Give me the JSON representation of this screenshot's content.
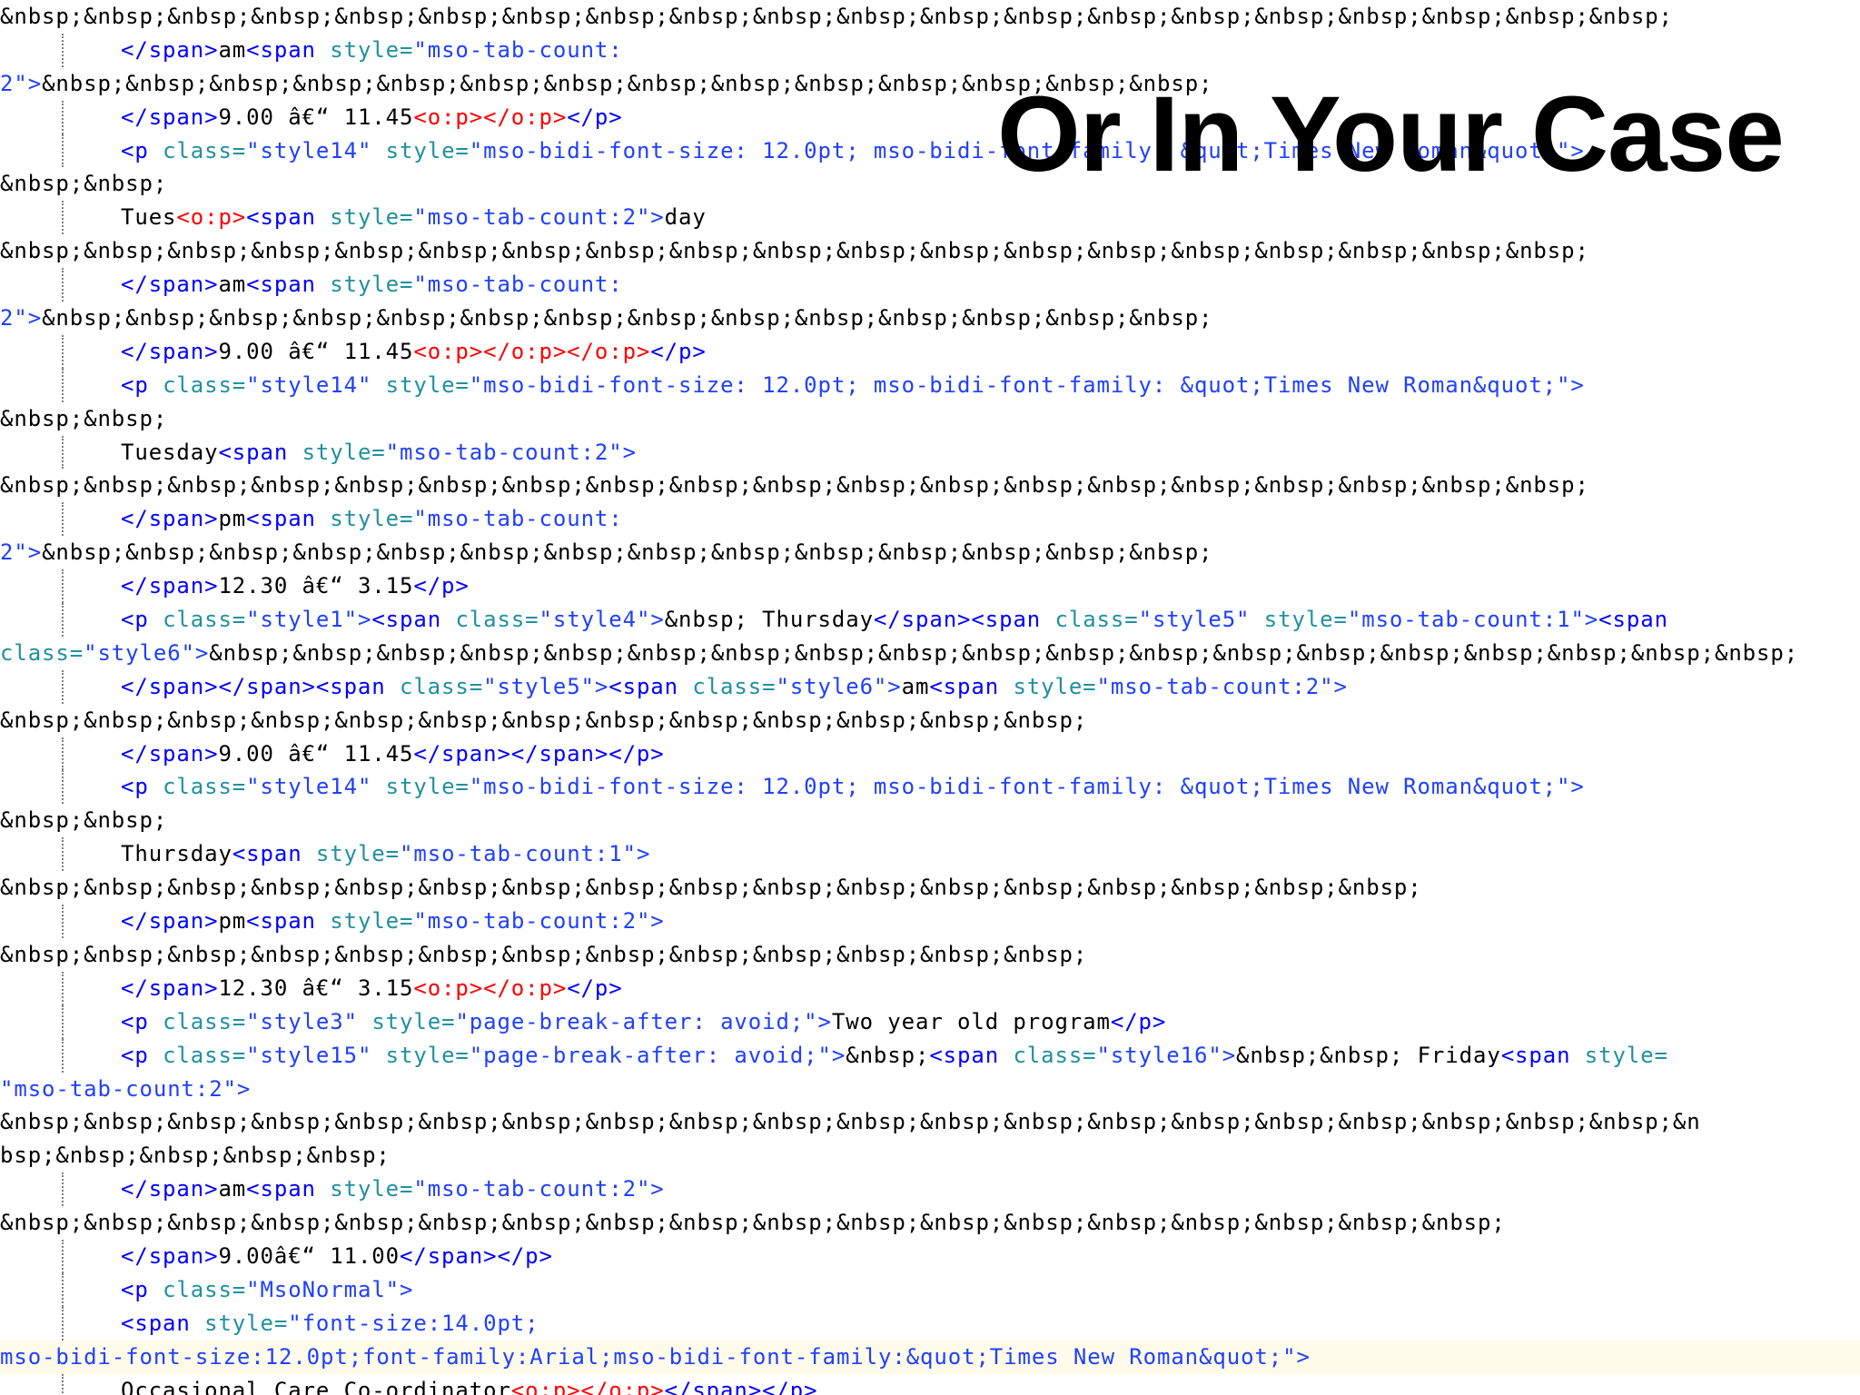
{
  "overlay_title": "Or In Your Case",
  "code_lines": [
    {
      "indent": false,
      "highlight": false,
      "segments": [
        {
          "k": "tx",
          "t": "&nbsp;&nbsp;&nbsp;&nbsp;&nbsp;&nbsp;&nbsp;&nbsp;&nbsp;&nbsp;&nbsp;&nbsp;&nbsp;&nbsp;&nbsp;&nbsp;&nbsp;&nbsp;&nbsp;&nbsp;"
        }
      ]
    },
    {
      "indent": true,
      "highlight": false,
      "segments": [
        {
          "k": "tg",
          "t": "</span>"
        },
        {
          "k": "tx",
          "t": "am"
        },
        {
          "k": "tg",
          "t": "<span "
        },
        {
          "k": "at",
          "t": "style="
        },
        {
          "k": "vl",
          "t": "\"mso-tab-count:"
        }
      ]
    },
    {
      "indent": false,
      "highlight": false,
      "segments": [
        {
          "k": "vl",
          "t": "2\">"
        },
        {
          "k": "tx",
          "t": "&nbsp;&nbsp;&nbsp;&nbsp;&nbsp;&nbsp;&nbsp;&nbsp;&nbsp;&nbsp;&nbsp;&nbsp;&nbsp;&nbsp;"
        }
      ]
    },
    {
      "indent": true,
      "highlight": false,
      "segments": [
        {
          "k": "tg",
          "t": "</span>"
        },
        {
          "k": "tx",
          "t": "9.00 â€“ 11.45"
        },
        {
          "k": "rd",
          "t": "<o:p></o:p>"
        },
        {
          "k": "tg",
          "t": "</p>"
        }
      ]
    },
    {
      "indent": true,
      "highlight": false,
      "segments": [
        {
          "k": "tg",
          "t": "<p "
        },
        {
          "k": "at",
          "t": "class="
        },
        {
          "k": "vl",
          "t": "\"style14\" "
        },
        {
          "k": "at",
          "t": "style="
        },
        {
          "k": "vl",
          "t": "\"mso-bidi-font-size: 12.0pt; mso-bidi-font-family: &quot;Times New Roman&quot;\">"
        }
      ]
    },
    {
      "indent": false,
      "highlight": false,
      "segments": [
        {
          "k": "tx",
          "t": "&nbsp;&nbsp;"
        }
      ]
    },
    {
      "indent": true,
      "highlight": false,
      "segments": [
        {
          "k": "tx",
          "t": "Tues"
        },
        {
          "k": "rd",
          "t": "<o:p>"
        },
        {
          "k": "tg",
          "t": "<span "
        },
        {
          "k": "at",
          "t": "style="
        },
        {
          "k": "vl",
          "t": "\"mso-tab-count:2\">"
        },
        {
          "k": "tx",
          "t": "day"
        }
      ]
    },
    {
      "indent": false,
      "highlight": false,
      "segments": [
        {
          "k": "tx",
          "t": "&nbsp;&nbsp;&nbsp;&nbsp;&nbsp;&nbsp;&nbsp;&nbsp;&nbsp;&nbsp;&nbsp;&nbsp;&nbsp;&nbsp;&nbsp;&nbsp;&nbsp;&nbsp;&nbsp;"
        }
      ]
    },
    {
      "indent": true,
      "highlight": false,
      "segments": [
        {
          "k": "tg",
          "t": "</span>"
        },
        {
          "k": "tx",
          "t": "am"
        },
        {
          "k": "tg",
          "t": "<span "
        },
        {
          "k": "at",
          "t": "style="
        },
        {
          "k": "vl",
          "t": "\"mso-tab-count:"
        }
      ]
    },
    {
      "indent": false,
      "highlight": false,
      "segments": [
        {
          "k": "vl",
          "t": "2\">"
        },
        {
          "k": "tx",
          "t": "&nbsp;&nbsp;&nbsp;&nbsp;&nbsp;&nbsp;&nbsp;&nbsp;&nbsp;&nbsp;&nbsp;&nbsp;&nbsp;&nbsp;"
        }
      ]
    },
    {
      "indent": true,
      "highlight": false,
      "segments": [
        {
          "k": "tg",
          "t": "</span>"
        },
        {
          "k": "tx",
          "t": "9.00 â€“ 11.45"
        },
        {
          "k": "rd",
          "t": "<o:p></o:p></o:p>"
        },
        {
          "k": "tg",
          "t": "</p>"
        }
      ]
    },
    {
      "indent": true,
      "highlight": false,
      "segments": [
        {
          "k": "tg",
          "t": "<p "
        },
        {
          "k": "at",
          "t": "class="
        },
        {
          "k": "vl",
          "t": "\"style14\" "
        },
        {
          "k": "at",
          "t": "style="
        },
        {
          "k": "vl",
          "t": "\"mso-bidi-font-size: 12.0pt; mso-bidi-font-family: &quot;Times New Roman&quot;\">"
        }
      ]
    },
    {
      "indent": false,
      "highlight": false,
      "segments": [
        {
          "k": "tx",
          "t": "&nbsp;&nbsp;"
        }
      ]
    },
    {
      "indent": true,
      "highlight": false,
      "segments": [
        {
          "k": "tx",
          "t": "Tuesday"
        },
        {
          "k": "tg",
          "t": "<span "
        },
        {
          "k": "at",
          "t": "style="
        },
        {
          "k": "vl",
          "t": "\"mso-tab-count:2\">"
        }
      ]
    },
    {
      "indent": false,
      "highlight": false,
      "segments": [
        {
          "k": "tx",
          "t": "&nbsp;&nbsp;&nbsp;&nbsp;&nbsp;&nbsp;&nbsp;&nbsp;&nbsp;&nbsp;&nbsp;&nbsp;&nbsp;&nbsp;&nbsp;&nbsp;&nbsp;&nbsp;&nbsp;"
        }
      ]
    },
    {
      "indent": true,
      "highlight": false,
      "segments": [
        {
          "k": "tg",
          "t": "</span>"
        },
        {
          "k": "tx",
          "t": "pm"
        },
        {
          "k": "tg",
          "t": "<span "
        },
        {
          "k": "at",
          "t": "style="
        },
        {
          "k": "vl",
          "t": "\"mso-tab-count:"
        }
      ]
    },
    {
      "indent": false,
      "highlight": false,
      "segments": [
        {
          "k": "vl",
          "t": "2\">"
        },
        {
          "k": "tx",
          "t": "&nbsp;&nbsp;&nbsp;&nbsp;&nbsp;&nbsp;&nbsp;&nbsp;&nbsp;&nbsp;&nbsp;&nbsp;&nbsp;&nbsp;"
        }
      ]
    },
    {
      "indent": true,
      "highlight": false,
      "segments": [
        {
          "k": "tg",
          "t": "</span>"
        },
        {
          "k": "tx",
          "t": "12.30 â€“ 3.15"
        },
        {
          "k": "tg",
          "t": "</p>"
        }
      ]
    },
    {
      "indent": true,
      "highlight": false,
      "segments": [
        {
          "k": "tg",
          "t": "<p "
        },
        {
          "k": "at",
          "t": "class="
        },
        {
          "k": "vl",
          "t": "\"style1\">"
        },
        {
          "k": "tg",
          "t": "<span "
        },
        {
          "k": "at",
          "t": "class="
        },
        {
          "k": "vl",
          "t": "\"style4\">"
        },
        {
          "k": "tx",
          "t": "&nbsp; Thursday"
        },
        {
          "k": "tg",
          "t": "</span><span "
        },
        {
          "k": "at",
          "t": "class="
        },
        {
          "k": "vl",
          "t": "\"style5\" "
        },
        {
          "k": "at",
          "t": "style="
        },
        {
          "k": "vl",
          "t": "\"mso-tab-count:1\">"
        },
        {
          "k": "tg",
          "t": "<span"
        }
      ]
    },
    {
      "indent": false,
      "highlight": false,
      "segments": [
        {
          "k": "at",
          "t": "class="
        },
        {
          "k": "vl",
          "t": "\"style6\">"
        },
        {
          "k": "tx",
          "t": "&nbsp;&nbsp;&nbsp;&nbsp;&nbsp;&nbsp;&nbsp;&nbsp;&nbsp;&nbsp;&nbsp;&nbsp;&nbsp;&nbsp;&nbsp;&nbsp;&nbsp;&nbsp;&nbsp;"
        }
      ]
    },
    {
      "indent": true,
      "highlight": false,
      "segments": [
        {
          "k": "tg",
          "t": "</span></span><span "
        },
        {
          "k": "at",
          "t": "class="
        },
        {
          "k": "vl",
          "t": "\"style5\">"
        },
        {
          "k": "tg",
          "t": "<span "
        },
        {
          "k": "at",
          "t": "class="
        },
        {
          "k": "vl",
          "t": "\"style6\">"
        },
        {
          "k": "tx",
          "t": "am"
        },
        {
          "k": "tg",
          "t": "<span "
        },
        {
          "k": "at",
          "t": "style="
        },
        {
          "k": "vl",
          "t": "\"mso-tab-count:2\">"
        }
      ]
    },
    {
      "indent": false,
      "highlight": false,
      "segments": [
        {
          "k": "tx",
          "t": "&nbsp;&nbsp;&nbsp;&nbsp;&nbsp;&nbsp;&nbsp;&nbsp;&nbsp;&nbsp;&nbsp;&nbsp;&nbsp;"
        }
      ]
    },
    {
      "indent": true,
      "highlight": false,
      "segments": [
        {
          "k": "tg",
          "t": "</span>"
        },
        {
          "k": "tx",
          "t": "9.00 â€“ 11.45"
        },
        {
          "k": "tg",
          "t": "</span></span></p>"
        }
      ]
    },
    {
      "indent": true,
      "highlight": false,
      "segments": [
        {
          "k": "tg",
          "t": "<p "
        },
        {
          "k": "at",
          "t": "class="
        },
        {
          "k": "vl",
          "t": "\"style14\" "
        },
        {
          "k": "at",
          "t": "style="
        },
        {
          "k": "vl",
          "t": "\"mso-bidi-font-size: 12.0pt; mso-bidi-font-family: &quot;Times New Roman&quot;\">"
        }
      ]
    },
    {
      "indent": false,
      "highlight": false,
      "segments": [
        {
          "k": "tx",
          "t": "&nbsp;&nbsp;"
        }
      ]
    },
    {
      "indent": true,
      "highlight": false,
      "segments": [
        {
          "k": "tx",
          "t": "Thursday"
        },
        {
          "k": "tg",
          "t": "<span "
        },
        {
          "k": "at",
          "t": "style="
        },
        {
          "k": "vl",
          "t": "\"mso-tab-count:1\">"
        }
      ]
    },
    {
      "indent": false,
      "highlight": false,
      "segments": [
        {
          "k": "tx",
          "t": "&nbsp;&nbsp;&nbsp;&nbsp;&nbsp;&nbsp;&nbsp;&nbsp;&nbsp;&nbsp;&nbsp;&nbsp;&nbsp;&nbsp;&nbsp;&nbsp;&nbsp;"
        }
      ]
    },
    {
      "indent": true,
      "highlight": false,
      "segments": [
        {
          "k": "tg",
          "t": "</span>"
        },
        {
          "k": "tx",
          "t": "pm"
        },
        {
          "k": "tg",
          "t": "<span "
        },
        {
          "k": "at",
          "t": "style="
        },
        {
          "k": "vl",
          "t": "\"mso-tab-count:2\">"
        }
      ]
    },
    {
      "indent": false,
      "highlight": false,
      "segments": [
        {
          "k": "tx",
          "t": "&nbsp;&nbsp;&nbsp;&nbsp;&nbsp;&nbsp;&nbsp;&nbsp;&nbsp;&nbsp;&nbsp;&nbsp;&nbsp;"
        }
      ]
    },
    {
      "indent": true,
      "highlight": false,
      "segments": [
        {
          "k": "tg",
          "t": "</span>"
        },
        {
          "k": "tx",
          "t": "12.30 â€“ 3.15"
        },
        {
          "k": "rd",
          "t": "<o:p></o:p>"
        },
        {
          "k": "tg",
          "t": "</p>"
        }
      ]
    },
    {
      "indent": true,
      "highlight": false,
      "segments": [
        {
          "k": "tg",
          "t": "<p "
        },
        {
          "k": "at",
          "t": "class="
        },
        {
          "k": "vl",
          "t": "\"style3\" "
        },
        {
          "k": "at",
          "t": "style="
        },
        {
          "k": "vl",
          "t": "\"page-break-after: avoid;\">"
        },
        {
          "k": "tx",
          "t": "Two year old program"
        },
        {
          "k": "tg",
          "t": "</p>"
        }
      ]
    },
    {
      "indent": true,
      "highlight": false,
      "segments": [
        {
          "k": "tg",
          "t": "<p "
        },
        {
          "k": "at",
          "t": "class="
        },
        {
          "k": "vl",
          "t": "\"style15\" "
        },
        {
          "k": "at",
          "t": "style="
        },
        {
          "k": "vl",
          "t": "\"page-break-after: avoid;\">"
        },
        {
          "k": "tx",
          "t": "&nbsp;"
        },
        {
          "k": "tg",
          "t": "<span "
        },
        {
          "k": "at",
          "t": "class="
        },
        {
          "k": "vl",
          "t": "\"style16\">"
        },
        {
          "k": "tx",
          "t": "&nbsp;&nbsp; Friday"
        },
        {
          "k": "tg",
          "t": "<span "
        },
        {
          "k": "at",
          "t": "style="
        }
      ]
    },
    {
      "indent": false,
      "highlight": false,
      "segments": [
        {
          "k": "vl",
          "t": "\"mso-tab-count:2\">"
        }
      ]
    },
    {
      "indent": false,
      "highlight": false,
      "segments": [
        {
          "k": "tx",
          "t": "&nbsp;&nbsp;&nbsp;&nbsp;&nbsp;&nbsp;&nbsp;&nbsp;&nbsp;&nbsp;&nbsp;&nbsp;&nbsp;&nbsp;&nbsp;&nbsp;&nbsp;&nbsp;&nbsp;&nbsp;&n"
        }
      ]
    },
    {
      "indent": false,
      "highlight": false,
      "segments": [
        {
          "k": "tx",
          "t": "bsp;&nbsp;&nbsp;&nbsp;&nbsp;"
        }
      ]
    },
    {
      "indent": true,
      "highlight": false,
      "segments": [
        {
          "k": "tg",
          "t": "</span>"
        },
        {
          "k": "tx",
          "t": "am"
        },
        {
          "k": "tg",
          "t": "<span "
        },
        {
          "k": "at",
          "t": "style="
        },
        {
          "k": "vl",
          "t": "\"mso-tab-count:2\">"
        }
      ]
    },
    {
      "indent": false,
      "highlight": false,
      "segments": [
        {
          "k": "tx",
          "t": "&nbsp;&nbsp;&nbsp;&nbsp;&nbsp;&nbsp;&nbsp;&nbsp;&nbsp;&nbsp;&nbsp;&nbsp;&nbsp;&nbsp;&nbsp;&nbsp;&nbsp;&nbsp;"
        }
      ]
    },
    {
      "indent": true,
      "highlight": false,
      "segments": [
        {
          "k": "tg",
          "t": "</span>"
        },
        {
          "k": "tx",
          "t": "9.00â€“ 11.00"
        },
        {
          "k": "tg",
          "t": "</span></p>"
        }
      ]
    },
    {
      "indent": true,
      "highlight": false,
      "segments": [
        {
          "k": "tg",
          "t": "<p "
        },
        {
          "k": "at",
          "t": "class="
        },
        {
          "k": "vl",
          "t": "\"MsoNormal\">"
        }
      ]
    },
    {
      "indent": true,
      "highlight": false,
      "segments": [
        {
          "k": "tg",
          "t": "<span "
        },
        {
          "k": "at",
          "t": "style="
        },
        {
          "k": "vl",
          "t": "\"font-size:14.0pt;"
        }
      ]
    },
    {
      "indent": false,
      "highlight": true,
      "segments": [
        {
          "k": "vl",
          "t": "mso-bidi-font-size:12.0pt;font-family:Arial;mso-bidi-font-family:&quot;Times New Roman&quot;\">"
        }
      ]
    },
    {
      "indent": true,
      "highlight": false,
      "segments": [
        {
          "k": "tx",
          "t": "Occasional Care Co-ordinator"
        },
        {
          "k": "rd",
          "t": "<o:p></o:p>"
        },
        {
          "k": "tg",
          "t": "</span></p>"
        }
      ]
    }
  ]
}
